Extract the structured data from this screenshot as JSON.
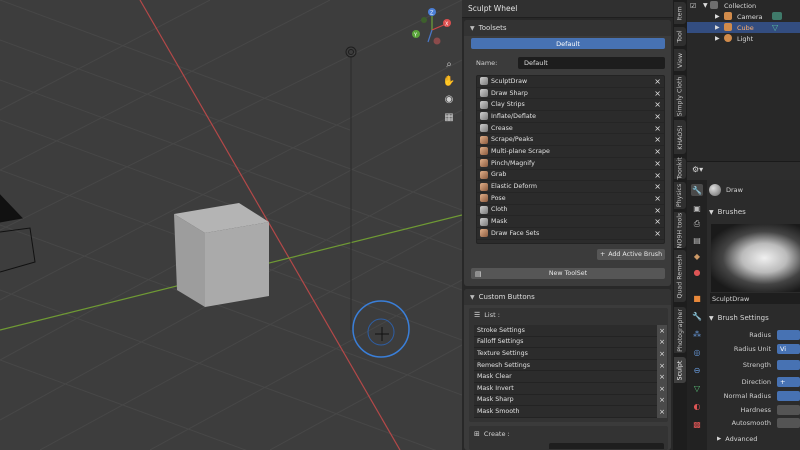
{
  "sculpt_wheel": {
    "title": "Sculpt Wheel",
    "toolsets": {
      "header": "Toolsets",
      "active_toolset": "Default",
      "name_label": "Name:",
      "name_value": "Default",
      "brushes": [
        {
          "label": "SculptDraw",
          "icon": "gray"
        },
        {
          "label": "Draw Sharp",
          "icon": "gray"
        },
        {
          "label": "Clay Strips",
          "icon": "gray"
        },
        {
          "label": "Inflate/Deflate",
          "icon": "gray"
        },
        {
          "label": "Crease",
          "icon": "gray"
        },
        {
          "label": "Scrape/Peaks",
          "icon": "orange"
        },
        {
          "label": "Multi-plane Scrape",
          "icon": "orange"
        },
        {
          "label": "Pinch/Magnify",
          "icon": "orange"
        },
        {
          "label": "Grab",
          "icon": "orange"
        },
        {
          "label": "Elastic Deform",
          "icon": "orange"
        },
        {
          "label": "Pose",
          "icon": "orange"
        },
        {
          "label": "Cloth",
          "icon": "gray"
        },
        {
          "label": "Mask",
          "icon": "gray"
        },
        {
          "label": "Draw Face Sets",
          "icon": "orange"
        }
      ],
      "remove_glyph": "×",
      "add_active_brush": "Add Active Brush",
      "new_toolset": "New ToolSet"
    },
    "custom_buttons": {
      "header": "Custom Buttons",
      "list_label": "List :",
      "items": [
        "Stroke Settings",
        "Falloff Settings",
        "Texture Settings",
        "Remesh Settings",
        "Mask  Clear",
        "Mask Invert",
        "Mask Sharp",
        "Mask Smooth"
      ],
      "create_label": "Create :"
    }
  },
  "side_tabs": [
    "Item",
    "Tool",
    "View",
    "Simply Cloth",
    "KHAOS!",
    "Toonkit",
    "Physics",
    "NO9H tools",
    "Quad Remesh",
    "Photographer",
    "Sculpt"
  ],
  "outliner": {
    "items": [
      {
        "label": "Collection",
        "selected": false
      },
      {
        "label": "Camera",
        "selected": false
      },
      {
        "label": "Cube",
        "selected": true
      },
      {
        "label": "Light",
        "selected": false
      }
    ]
  },
  "properties": {
    "brush_name": "Draw",
    "brushes_header": "Brushes",
    "brush_datablock": "SculptDraw",
    "brush_settings_header": "Brush Settings",
    "fields": [
      {
        "label": "Radius",
        "value": ""
      },
      {
        "label": "Radius Unit",
        "value": "Vi"
      },
      {
        "label": "Strength",
        "value": ""
      },
      {
        "label": "Direction",
        "value": "+"
      },
      {
        "label": "Normal Radius",
        "value": ""
      },
      {
        "label": "Hardness",
        "value": ""
      },
      {
        "label": "Autosmooth",
        "value": ""
      }
    ],
    "advanced_header": "Advanced"
  },
  "colors": {
    "accent_blue": "#4772b3",
    "selected_row": "#334d80",
    "x_axis": "#b34848",
    "y_axis": "#7aa534",
    "brush_cursor": "#3a7fd9"
  },
  "icons": [
    "zoom-icon",
    "hand-pan-icon",
    "camera-icon",
    "grid-icon",
    "navigation-gizmo-icon",
    "light-icon"
  ]
}
